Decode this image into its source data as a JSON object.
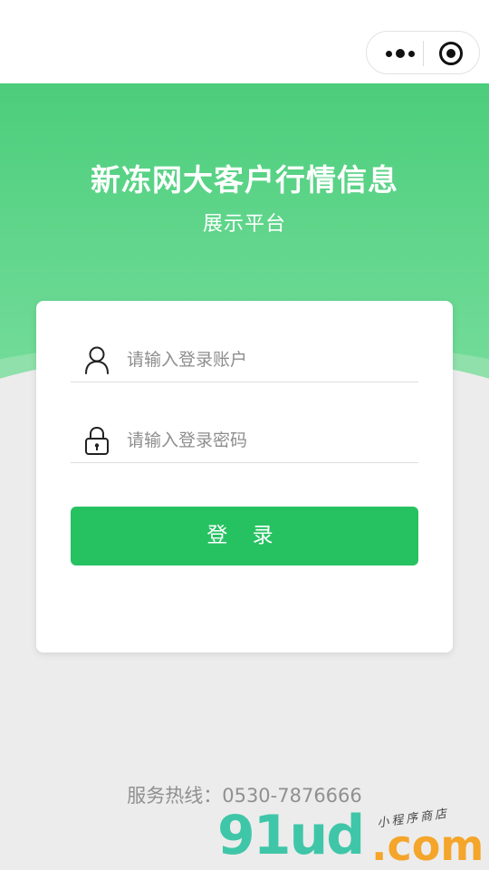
{
  "header": {
    "title": "新冻网大客户行情信息",
    "subtitle": "展示平台"
  },
  "capsule": {
    "more_icon": "more-dots-icon",
    "close_icon": "target-circle-icon"
  },
  "form": {
    "username": {
      "placeholder": "请输入登录账户",
      "value": "",
      "icon": "user-icon"
    },
    "password": {
      "placeholder": "请输入登录密码",
      "value": "",
      "icon": "lock-icon"
    },
    "login_label": "登 录"
  },
  "footer": {
    "hotline": "服务热线：0530-7876666"
  },
  "watermark": {
    "logo_text": "91ud",
    "domain": ".com",
    "tagline": "小程序商店"
  },
  "colors": {
    "primary_green": "#26c262",
    "header_green": "#4ccd7b",
    "background": "#ececec"
  }
}
